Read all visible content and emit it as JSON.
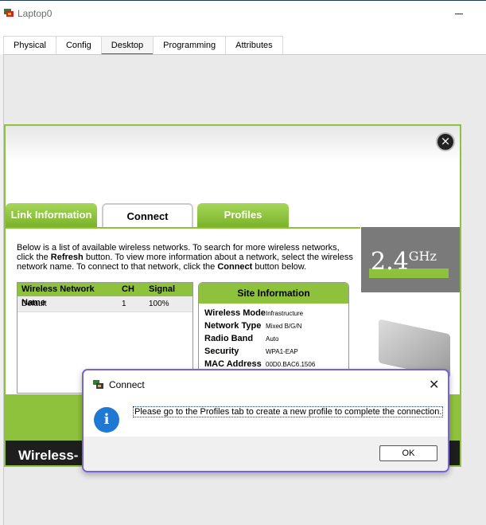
{
  "window": {
    "title": "Laptop0"
  },
  "tabs": [
    "Physical",
    "Config",
    "Desktop",
    "Programming",
    "Attributes"
  ],
  "active_tab": "Desktop",
  "wireless_app": {
    "tabs": {
      "link_information": "Link Information",
      "connect": "Connect",
      "profiles": "Profiles"
    },
    "intro": {
      "part1": "Below is a list of available wireless networks. To search for more wireless networks, click the ",
      "refresh": "Refresh",
      "part2": " button. To view more information about a network, select the wireless network name. To connect to that network, click the ",
      "connect": "Connect",
      "part3": " button below."
    },
    "network_table": {
      "headers": [
        "Wireless Network Name",
        "CH",
        "Signal"
      ],
      "rows": [
        {
          "name": "Default",
          "ch": "1",
          "signal": "100%"
        }
      ]
    },
    "site_info": {
      "title": "Site Information",
      "rows": [
        {
          "key": "Wireless Mode",
          "value": "Infrastructure"
        },
        {
          "key": "Network Type",
          "value": "Mixed B/G/N"
        },
        {
          "key": "Radio Band",
          "value": "Auto"
        },
        {
          "key": "Security",
          "value": "WPA1-EAP"
        },
        {
          "key": "MAC Address",
          "value": "00D0.BAC6.1506"
        }
      ]
    },
    "frequency": {
      "number": "2.4",
      "unit": "GHz"
    },
    "footer": "Wireless-"
  },
  "dialog": {
    "title": "Connect",
    "message": "Please go to the Profiles tab to create a new profile to complete the connection.",
    "ok_label": "OK",
    "icon": "info-icon",
    "border_color": "#7a63d4"
  },
  "colors": {
    "accent_green": "#8fc23c",
    "info_blue": "#1f78d1",
    "active_tab_underline": "#1a6ec2"
  }
}
